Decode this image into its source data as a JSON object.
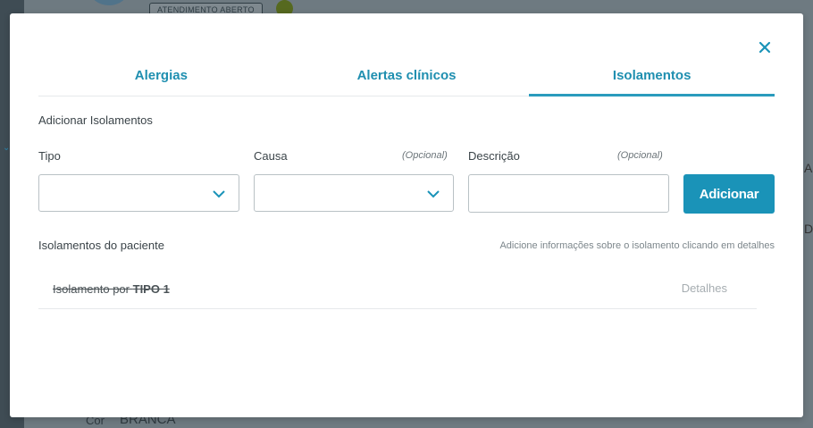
{
  "background": {
    "badge": "ATENDIMENTO ABERTO",
    "edge_letter_1": "A",
    "edge_letter_2": "D",
    "cor_label": "Cor",
    "cor_value": "BRANCA"
  },
  "tabs": [
    {
      "label": "Alergias",
      "active": false
    },
    {
      "label": "Alertas clínicos",
      "active": false
    },
    {
      "label": "Isolamentos",
      "active": true
    }
  ],
  "form": {
    "section_title": "Adicionar Isolamentos",
    "tipo_label": "Tipo",
    "causa_label": "Causa",
    "causa_optional": "(Opcional)",
    "descricao_label": "Descrição",
    "descricao_optional": "(Opcional)",
    "descricao_value": "",
    "add_button": "Adicionar"
  },
  "list": {
    "title": "Isolamentos do paciente",
    "hint": "Adicione informações sobre o isolamento clicando em detalhes",
    "items": [
      {
        "prefix": "Isolamento por",
        "type": "TIPO 1",
        "details": "Detalhes"
      }
    ]
  },
  "icons": {
    "close": "close-icon",
    "select_chevron": "chevron-down-icon"
  },
  "colors": {
    "accent": "#1a93b8",
    "tab_text": "#1f8fb0"
  }
}
